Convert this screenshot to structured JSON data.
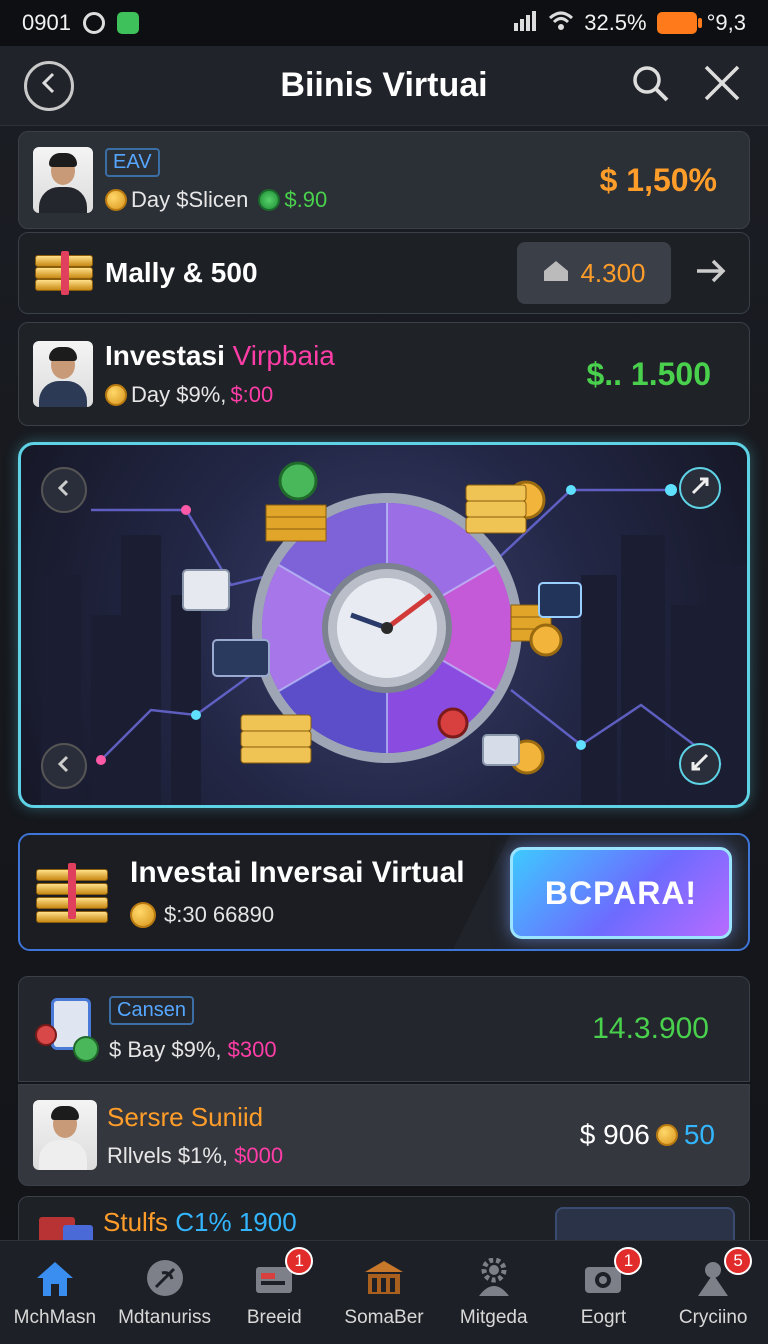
{
  "status_bar": {
    "time": "0901",
    "signal_text": "32.5%",
    "extra": "°9,3"
  },
  "header": {
    "title": "Biinis Virtuai"
  },
  "items": [
    {
      "tag": "EAV",
      "subtitle_a": "Day $Slicen",
      "subtitle_b": "$.90",
      "value": "$ 1,50%"
    },
    {
      "title": "Mally & 500",
      "button_value": "4.300"
    },
    {
      "title_a": "Investasi",
      "title_b": "Virpbaia",
      "subtitle_a": "Day $9%,",
      "subtitle_b": "$:00",
      "value": "$.. 1.500"
    },
    {
      "tag": "Cansen",
      "subtitle_a": "$ Bay $9%,",
      "subtitle_b": "$300",
      "value": "14.3.900"
    },
    {
      "title": "Sersre Suniid",
      "subtitle_a": "Rllvels $1%,",
      "subtitle_b": "$000",
      "value_a": "$ 906",
      "value_b": "50"
    },
    {
      "title_a": "Stulfs",
      "title_b": "C1% 1900"
    }
  ],
  "promo": {
    "title": "Investai Inversai Virtual",
    "subtitle": "$:30 66890",
    "button_label": "BCPARA!"
  },
  "nav": [
    {
      "label": "MchMasn",
      "icon": "home-icon",
      "badge": ""
    },
    {
      "label": "Mdtanuriss",
      "icon": "leaf-icon",
      "badge": ""
    },
    {
      "label": "Breeid",
      "icon": "wallet-icon",
      "badge": "1"
    },
    {
      "label": "SomaBer",
      "icon": "bank-icon",
      "badge": ""
    },
    {
      "label": "Mitgeda",
      "icon": "gear-person-icon",
      "badge": ""
    },
    {
      "label": "Eogrt",
      "icon": "camera-icon",
      "badge": "1"
    },
    {
      "label": "Cryciino",
      "icon": "user-icon",
      "badge": "5"
    }
  ],
  "colors": {
    "accent_green": "#49d04c",
    "accent_orange": "#ff9d2a",
    "accent_pink": "#ff3da7",
    "hero_border": "#5fd3e6"
  }
}
